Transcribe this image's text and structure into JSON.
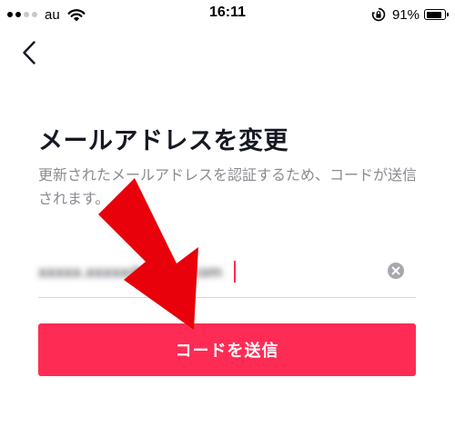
{
  "status_bar": {
    "carrier": "au",
    "time": "16:11",
    "battery_percent_label": "91%",
    "battery_level": 0.91,
    "signal_bars_filled": 2,
    "signal_bars_total": 4,
    "icons": [
      "wifi-icon",
      "rotation-lock-icon",
      "battery-icon"
    ]
  },
  "nav": {
    "back_icon": "chevron-left-icon"
  },
  "page": {
    "title": "メールアドレスを変更",
    "description": "更新されたメールアドレスを認証するため、コードが送信されます。"
  },
  "email_field": {
    "value": "xxxxx.xxxxx@xxxxx.com",
    "clear_icon": "clear-circle-icon"
  },
  "send_code_button": {
    "label": "コードを送信"
  },
  "colors": {
    "accent": "#fe2c55",
    "annotation_arrow": "#e8000b",
    "text_primary": "#161823",
    "text_secondary": "#8a8b91"
  }
}
